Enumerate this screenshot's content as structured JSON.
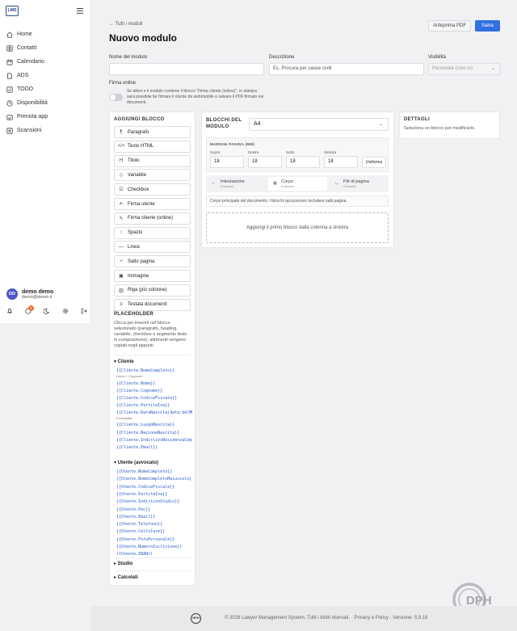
{
  "app": {
    "logo": "LMS"
  },
  "nav": [
    {
      "label": "Home",
      "icon": "home-icon"
    },
    {
      "label": "Contatti",
      "icon": "contacts-icon"
    },
    {
      "label": "Calendario",
      "icon": "calendar-icon"
    },
    {
      "label": "ADS",
      "icon": "document-icon"
    },
    {
      "label": "TODO",
      "icon": "checkbox-icon"
    },
    {
      "label": "Disponibilità",
      "icon": "clock-icon"
    },
    {
      "label": "Prenota app",
      "icon": "booking-icon"
    },
    {
      "label": "Scansioni",
      "icon": "scan-icon"
    }
  ],
  "user": {
    "initials": "DD",
    "name": "demo demo",
    "email": "demo@demo.it",
    "notifications": "2"
  },
  "header": {
    "back": "← Tutti i moduli",
    "title": "Nuovo modulo",
    "preview": "Anteprima PDF",
    "save": "Salva"
  },
  "form": {
    "name_label": "Nome del modulo",
    "name_value": "",
    "desc_label": "Descrizione",
    "desc_placeholder": "Es. Procura per cause civili",
    "vis_label": "Visibilità",
    "vis_value": "Personale (solo io)",
    "sign_label": "Firma online",
    "sign_desc": "Se attivo e il modulo contiene il blocco \"Firma cliente (online)\", in stampa sarà possibile far firmare il cliente da web/mobile e salvare il PDF firmato nei documenti."
  },
  "blocks": {
    "title": "AGGIUNGI BLOCCO",
    "items": [
      {
        "label": "Paragrafo",
        "icon": "¶"
      },
      {
        "label": "Testo HTML",
        "icon": "</>"
      },
      {
        "label": "Titolo",
        "icon": "H"
      },
      {
        "label": "Variabile",
        "icon": "◇"
      },
      {
        "label": "Checkbox",
        "icon": "☑"
      },
      {
        "label": "Firma utente",
        "icon": "✍"
      },
      {
        "label": "Firma cliente (online)",
        "icon": "✎"
      },
      {
        "label": "Spazio",
        "icon": "↕"
      },
      {
        "label": "Linea",
        "icon": "—"
      },
      {
        "label": "Salto pagina",
        "icon": "⤶"
      },
      {
        "label": "Immagine",
        "icon": "▣"
      },
      {
        "label": "Riga (più colonne)",
        "icon": "▥"
      },
      {
        "label": "Testata documenti",
        "icon": "≡"
      }
    ]
  },
  "placeholders": {
    "title": "PLACEHOLDER",
    "desc": "Clicca per inserirli nel blocco selezionato (paragrafo, heading, variabile, checkbox o segmento testo in composizione); altrimenti vengono copiati negli appunti.",
    "cliente_label": "▾ Cliente",
    "cliente": [
      "{{Cliente.NomeCompleto}}",
      "{{Cliente.Nome}}",
      "{{Cliente.Cognome}}",
      "{{Cliente.CodiceFiscale}}",
      "{{Cliente.PartitaIva}}",
      "{{Cliente.DataNascita|data:dd/MM/yyyy}}",
      "{{Cliente.LuogoNascita}}",
      "{{Cliente.NazioneNascita}}",
      "{{Cliente.IndirizzoResidenzaCompleto}}",
      "{{Cliente.Email}}"
    ],
    "cliente_sub1": "Nome + Cognome",
    "cliente_sub2": "Formattata",
    "utente_label": "▾ Utente (avvocato)",
    "utente": [
      "{{Utente.NomeCompleto}}",
      "{{Utente.NomeCompletoMaiuscolo}}",
      "{{Utente.CodiceFiscale}}",
      "{{Utente.PartitaIva}}",
      "{{Utente.IndirizzoStudio}}",
      "{{Utente.Pec}}",
      "{{Utente.Email}}",
      "{{Utente.Telefono}}",
      "{{Utente.Cellulare}}",
      "{{Utente.ForoPersonale}}",
      "{{Utente.NumeroIscrizione}}",
      "{{Utente.IBAN}}"
    ],
    "studio_label": "▸ Studio",
    "calcolati_label": "▸ Calcolati"
  },
  "module": {
    "title": "BLOCCHI DEL MODULO",
    "format": "A4",
    "margins_title": "MARGINI PAGINA (MM)",
    "margins": [
      {
        "label": "Sopra",
        "value": "18"
      },
      {
        "label": "Destra",
        "value": "18"
      },
      {
        "label": "Sotto",
        "value": "18"
      },
      {
        "label": "Sinistra",
        "value": "18"
      }
    ],
    "uniform": "Uniforma",
    "tabs": [
      {
        "label": "Intestazione",
        "count": "0 blocchi",
        "icon": "⌐"
      },
      {
        "label": "Corpo",
        "count": "0 blocchi",
        "icon": "▦"
      },
      {
        "label": "Piè di pagina",
        "count": "0 blocchi",
        "icon": "⌙"
      }
    ],
    "body_desc": "Corpo principale del documento. I blocchi qui possono includere salti pagina.",
    "drop": "Aggiungi il primo blocco dalla colonna a sinistra"
  },
  "details": {
    "title": "DETTAGLI",
    "desc": "Seleziona un blocco per modificarlo."
  },
  "footer": {
    "logo": "DPH",
    "text": "© 2026 Lawyer Management System. Tutti i diritti riservati. · Privacy e Policy · Versione: 5.9.18"
  }
}
